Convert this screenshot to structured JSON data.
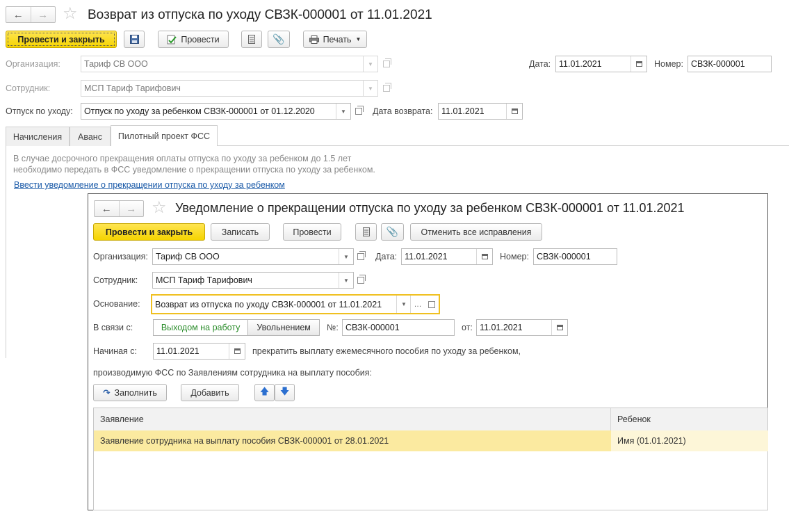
{
  "main": {
    "title": "Возврат из отпуска по уходу СВЗК-000001 от 11.01.2021",
    "toolbar": {
      "post_close": "Провести и закрыть",
      "post": "Провести",
      "print": "Печать"
    },
    "org_label": "Организация:",
    "org_value": "Тариф СВ ООО",
    "date_label": "Дата:",
    "date_value": "11.01.2021",
    "number_label": "Номер:",
    "number_value": "СВЗК-000001",
    "employee_label": "Сотрудник:",
    "employee_value": "МСП Тариф Тарифович",
    "leave_label": "Отпуск по уходу:",
    "leave_value": "Отпуск по уходу за ребенком СВЗК-000001 от 01.12.2020",
    "return_label": "Дата возврата:",
    "return_value": "11.01.2021",
    "tabs": [
      "Начисления",
      "Аванс",
      "Пилотный проект ФСС"
    ],
    "note_line1": "В случае досрочного прекращения оплаты отпуска по уходу за ребенком до 1.5 лет",
    "note_line2": "необходимо передать в ФСС уведомление о прекращении отпуска по уходу за ребенком.",
    "link": "Ввести уведомление о прекращении отпуска по уходу за ребенком"
  },
  "popup": {
    "title": "Уведомление о прекращении отпуска по уходу за ребенком СВЗК-000001 от 11.01.2021",
    "toolbar": {
      "post_close": "Провести и закрыть",
      "save": "Записать",
      "post": "Провести",
      "cancel_fixes": "Отменить все исправления"
    },
    "org_label": "Организация:",
    "org_value": "Тариф СВ ООО",
    "date_label": "Дата:",
    "date_value": "11.01.2021",
    "number_label": "Номер:",
    "number_value": "СВЗК-000001",
    "employee_label": "Сотрудник:",
    "employee_value": "МСП Тариф Тарифович",
    "basis_label": "Основание:",
    "basis_value": "Возврат из отпуска по уходу СВЗК-000001 от 11.01.2021",
    "reason_label": "В связи с:",
    "reason_options": [
      "Выходом на работу",
      "Увольнением"
    ],
    "no_label": "№:",
    "no_value": "СВЗК-000001",
    "from_label": "от:",
    "from_value": "11.01.2021",
    "start_label": "Начиная с:",
    "start_value": "11.01.2021",
    "stop_text": "прекратить выплату ежемесячного пособия по уходу за ребенком,",
    "produced_text": "производимую ФСС по Заявлениям сотрудника на выплату пособия:",
    "fill": "Заполнить",
    "add": "Добавить",
    "grid": {
      "columns": [
        "Заявление",
        "Ребенок"
      ],
      "rows": [
        {
          "application": "Заявление сотрудника на выплату пособия СВЗК-000001 от 28.01.2021",
          "child": "Имя (01.01.2021)"
        }
      ]
    }
  }
}
